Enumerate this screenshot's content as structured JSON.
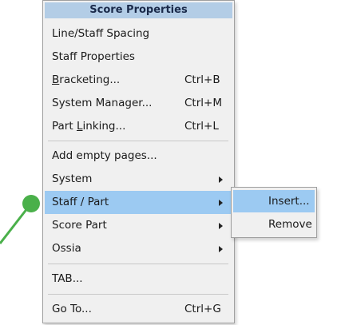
{
  "menu": {
    "header": "Score Properties",
    "items": [
      {
        "label": "Line/Staff Spacing",
        "shortcut": ""
      },
      {
        "label": "Staff Properties",
        "shortcut": ""
      },
      {
        "label_pre": "",
        "label_u": "B",
        "label_post": "racketing...",
        "shortcut": "Ctrl+B"
      },
      {
        "label": "System Manager...",
        "shortcut": "Ctrl+M"
      },
      {
        "label_pre": "Part ",
        "label_u": "L",
        "label_post": "inking...",
        "shortcut": "Ctrl+L"
      },
      {
        "label": "Add empty pages...",
        "shortcut": ""
      },
      {
        "label": "System",
        "shortcut": ""
      },
      {
        "label": "Staff / Part",
        "shortcut": ""
      },
      {
        "label": "Score Part",
        "shortcut": ""
      },
      {
        "label": "Ossia",
        "shortcut": ""
      },
      {
        "label": "TAB...",
        "shortcut": ""
      },
      {
        "label": "Go To...",
        "shortcut": "Ctrl+G"
      }
    ]
  },
  "submenu": {
    "items": [
      {
        "label": "Insert..."
      },
      {
        "label": "Remove"
      }
    ]
  },
  "colors": {
    "highlight": "#9ccaf2",
    "header_bg": "#b3cde6",
    "pointer": "#4ab04a"
  }
}
